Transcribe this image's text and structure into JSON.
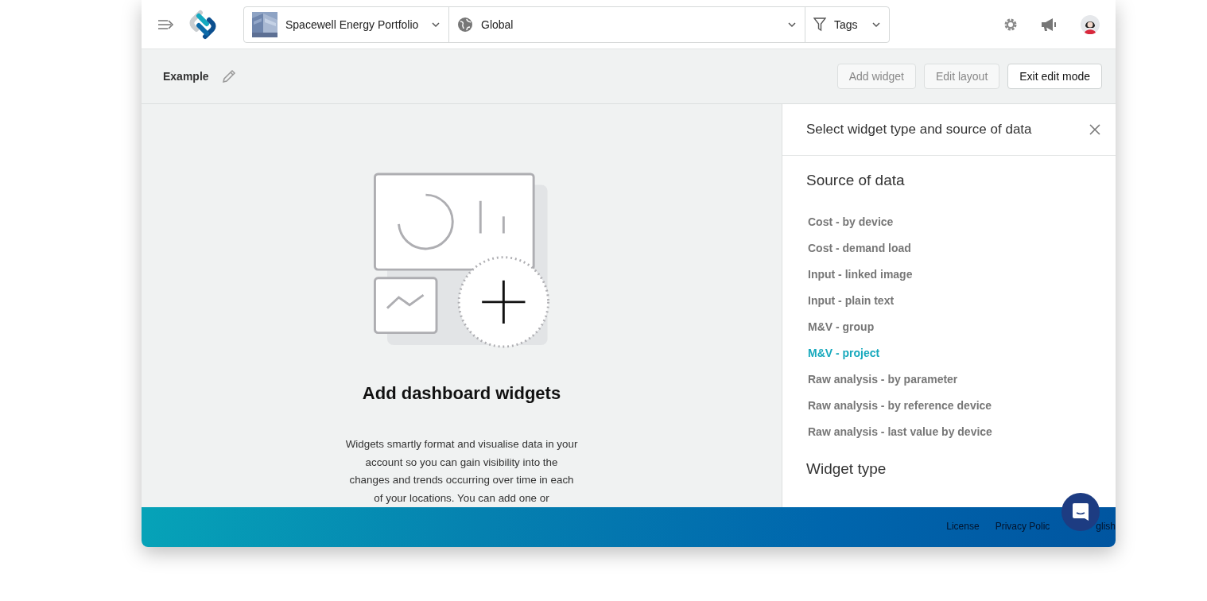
{
  "header": {
    "portfolio": "Spacewell Energy Portfolio",
    "location": "Global",
    "tags": "Tags"
  },
  "toolbar": {
    "title": "Example",
    "buttons": [
      {
        "label": "Add widget",
        "primary": false
      },
      {
        "label": "Edit layout",
        "primary": false
      },
      {
        "label": "Exit edit mode",
        "primary": true
      }
    ]
  },
  "empty_state": {
    "title": "Add dashboard widgets",
    "text": "Widgets smartly format and visualise data in your account so you can gain visibility into the changes and trends occurring over time in each of your locations. You can add one or"
  },
  "panel": {
    "title": "Select widget type and source of data",
    "source_heading": "Source of data",
    "sources": [
      {
        "label": "Cost - by device",
        "selected": false
      },
      {
        "label": "Cost - demand load",
        "selected": false
      },
      {
        "label": "Input - linked image",
        "selected": false
      },
      {
        "label": "Input - plain text",
        "selected": false
      },
      {
        "label": "M&V - group",
        "selected": false
      },
      {
        "label": "M&V - project",
        "selected": true
      },
      {
        "label": "Raw analysis - by parameter",
        "selected": false
      },
      {
        "label": "Raw analysis - by reference device",
        "selected": false
      },
      {
        "label": "Raw analysis - last value by device",
        "selected": false
      }
    ],
    "type_heading": "Widget type"
  },
  "footer": {
    "links": [
      "License",
      "Privacy Polic",
      "glish"
    ]
  }
}
